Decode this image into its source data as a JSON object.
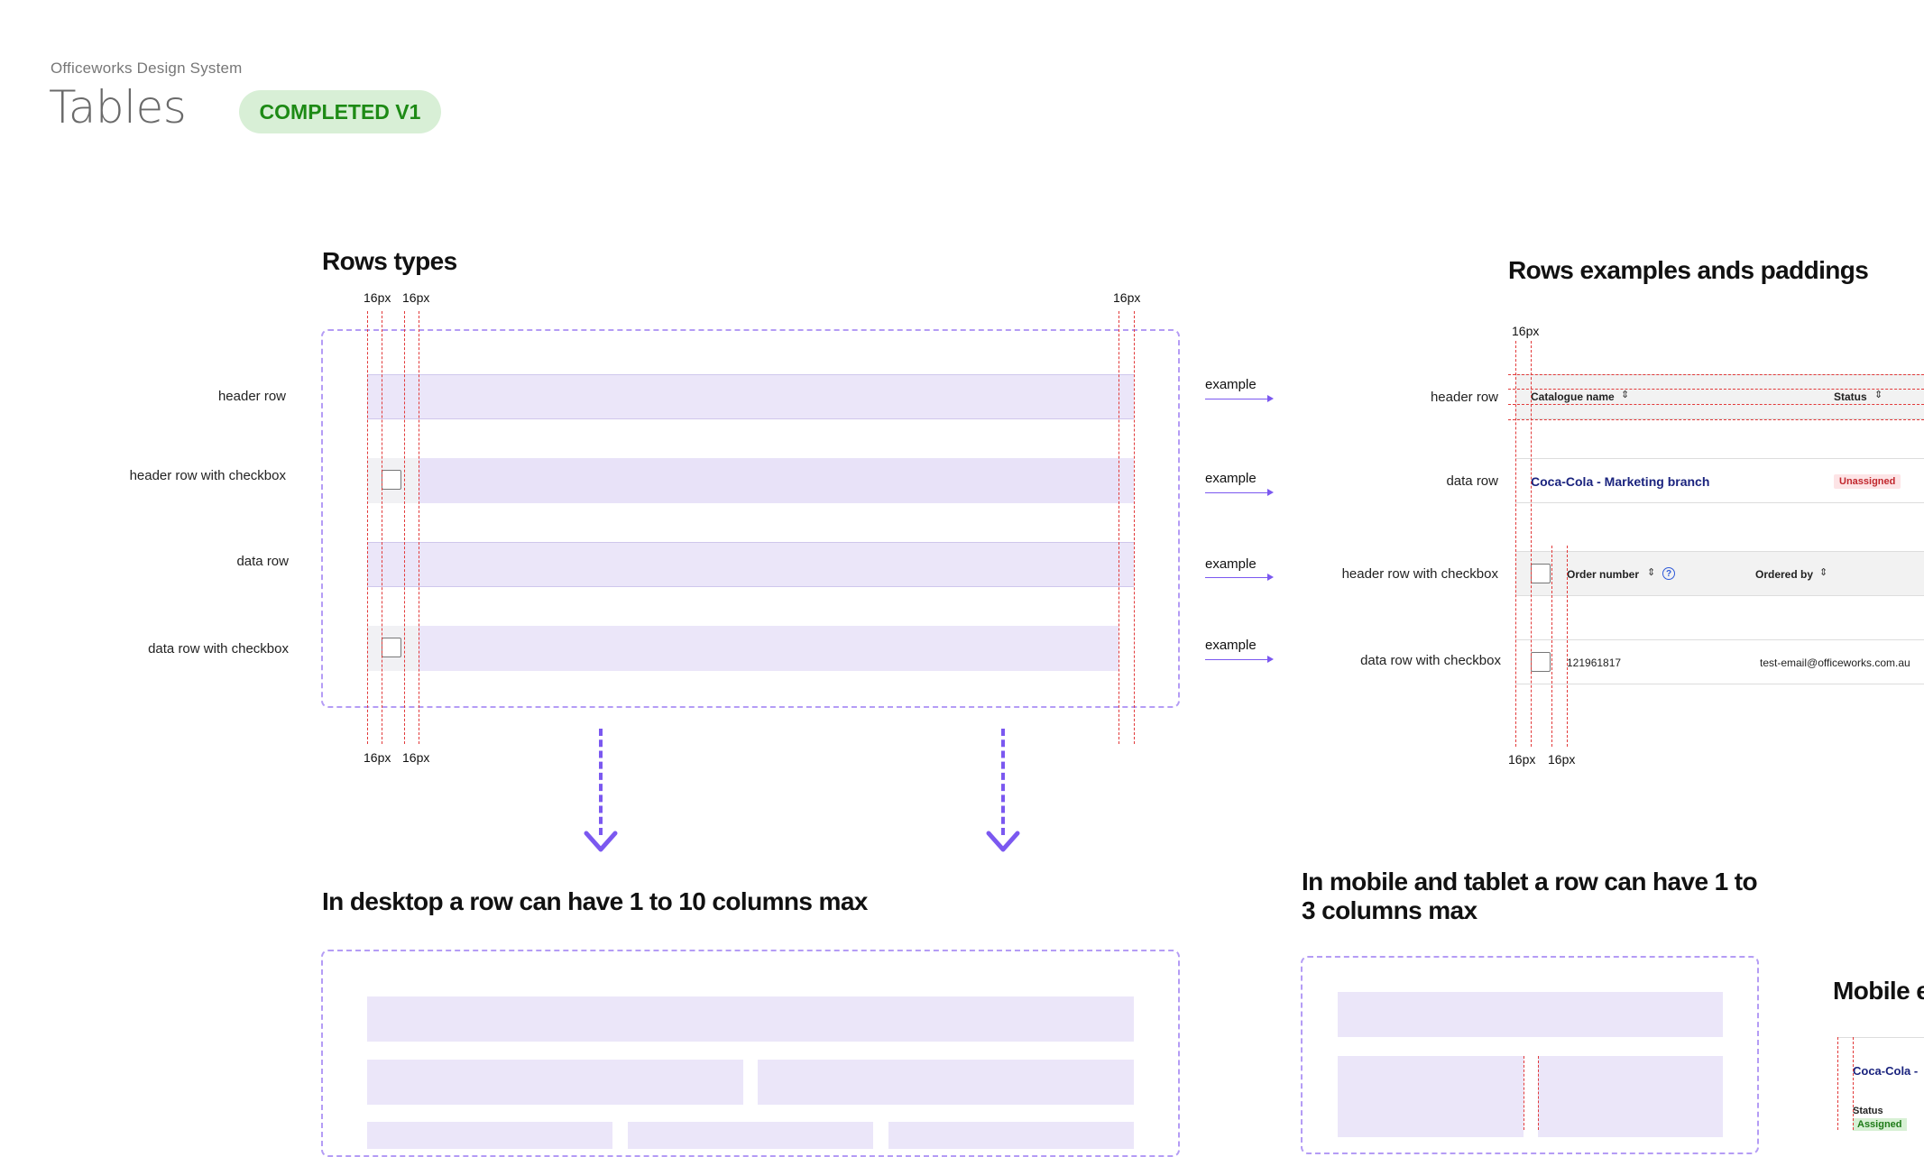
{
  "header": {
    "brand": "Officeworks Design System",
    "title": "Tables",
    "badge": "COMPLETED V1"
  },
  "sections": {
    "rows_types": "Rows types",
    "rows_examples": "Rows examples ands paddings",
    "desktop": "In desktop a row can have 1 to 10 columns max",
    "mobile": "In mobile and tablet a row can have 1 to 3 columns max",
    "mobile_example": "Mobile e"
  },
  "spacing_label": "16px",
  "row_labels": {
    "header_row": "header row",
    "header_row_checkbox": "header row with checkbox",
    "data_row": "data row",
    "data_row_checkbox": "data row with checkbox"
  },
  "example_label": "example",
  "examples": {
    "header1": {
      "catalogue": "Catalogue name",
      "status": "Status"
    },
    "data1": {
      "name": "Coca-Cola - Marketing branch",
      "status": "Unassigned"
    },
    "header2": {
      "order": "Order number",
      "ordered_by": "Ordered by"
    },
    "data2": {
      "order": "121961817",
      "email": "test-email@officeworks.com.au"
    }
  },
  "mobile_example": {
    "name": "Coca-Cola -",
    "status_label": "Status",
    "status": "Assigned"
  },
  "icons": {
    "sort": "sort-icon",
    "help": "help-icon",
    "checkbox": "checkbox-icon",
    "arrow": "arrow-right-icon"
  },
  "colors": {
    "accent": "#7b58f0",
    "row_fill": "#ebe6f9",
    "guide": "#e23a3a",
    "badge_bg": "#d8efd6",
    "badge_text": "#1d8a15"
  }
}
